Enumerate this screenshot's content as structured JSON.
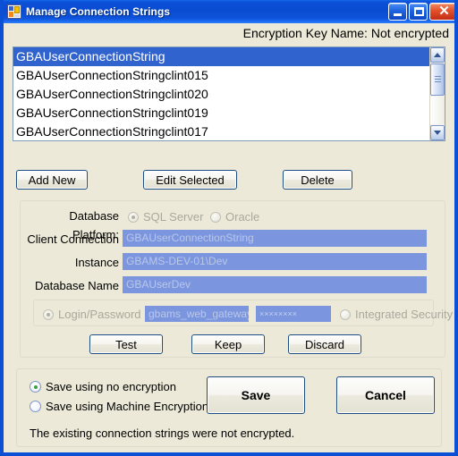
{
  "window": {
    "title": "Manage Connection Strings",
    "icon": "form-icon",
    "controls": {
      "minimize": "minimize-button",
      "maximize": "maximize-button",
      "close": "close-button",
      "close_glyph": "✕"
    }
  },
  "header": {
    "encryption_key_name": "Encryption Key Name: Not encrypted"
  },
  "connection_list": {
    "selected_index": 0,
    "items": [
      "GBAUserConnectionString",
      "GBAUserConnectionStringclint015",
      "GBAUserConnectionStringclint020",
      "GBAUserConnectionStringclint019",
      "GBAUserConnectionStringclint017"
    ]
  },
  "list_actions": {
    "add_new": "Add New",
    "edit_selected": "Edit Selected",
    "delete": "Delete"
  },
  "details": {
    "platform_label": "Database Platform:",
    "platform_options": [
      {
        "label": "SQL Server",
        "selected": true,
        "disabled": true
      },
      {
        "label": "Oracle",
        "selected": false,
        "disabled": true
      }
    ],
    "fields": [
      {
        "label": "Client Connection",
        "value": "GBAUserConnectionString"
      },
      {
        "label": "Instance",
        "value": "GBAMS-DEV-01\\Dev"
      },
      {
        "label": "Database Name",
        "value": "GBAUserDev"
      }
    ],
    "auth": {
      "login_password_label": "Login/Password",
      "login_password_selected": true,
      "integrated_security_label": "Integrated Security",
      "integrated_security_selected": false,
      "username_value": "gbams_web_gateway",
      "password_value": "××××××××"
    },
    "buttons": {
      "test": "Test",
      "keep": "Keep",
      "discard": "Discard"
    }
  },
  "save_panel": {
    "options": [
      {
        "label": "Save using no encryption",
        "selected": true
      },
      {
        "label": "Save using Machine Encryption",
        "selected": false
      }
    ],
    "save": "Save",
    "cancel": "Cancel",
    "status": "The existing connection strings were not encrypted."
  },
  "colors": {
    "titlebar_blue": "#0A4FD4",
    "dialog_face": "#ECE9D8",
    "selection_blue": "#3163CE",
    "field_blue": "#7B96DE",
    "field_text": "#B9C7EA",
    "button_border": "#1B4C82",
    "radio_dot_green": "#2F9E2F"
  }
}
